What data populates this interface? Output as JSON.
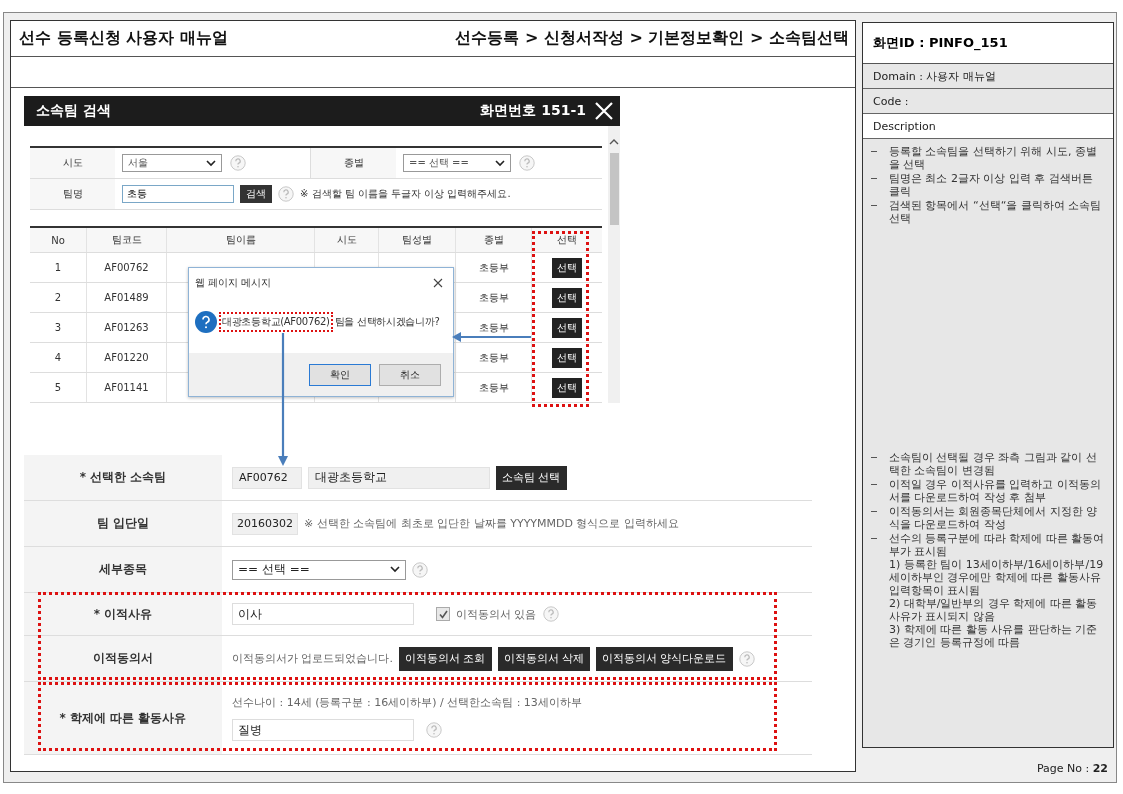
{
  "document": {
    "title": "선수 등록신청 사용자 매뉴얼",
    "breadcrumb": "선수등록 > 신청서작성 > 기본정보확인 > 소속팀선택"
  },
  "popup": {
    "title": "소속팀 검색",
    "screen_no": "화면번호 151-1",
    "filters": [
      {
        "label": "시도",
        "value": "서울"
      },
      {
        "label": "종별",
        "value": "== 선택 =="
      }
    ],
    "team_name": {
      "label": "팀명",
      "value": "초등",
      "button": "검색",
      "note": "※ 검색할 팀 이름을 두글자 이상 입력해주세요."
    },
    "columns": [
      "No",
      "팀코드",
      "팀이름",
      "시도",
      "팀성별",
      "종별",
      "선택"
    ],
    "rows": [
      {
        "no": "1",
        "code": "AF00762",
        "category": "초등부",
        "action": "선택"
      },
      {
        "no": "2",
        "code": "AF01489",
        "category": "초등부",
        "action": "선택"
      },
      {
        "no": "3",
        "code": "AF01263",
        "category": "초등부",
        "action": "선택"
      },
      {
        "no": "4",
        "code": "AF01220",
        "category": "초등부",
        "action": "선택"
      },
      {
        "no": "5",
        "code": "AF01141",
        "category": "초등부",
        "action": "선택"
      }
    ]
  },
  "dialog": {
    "title": "웹 페이지 메시지",
    "team": "대광초등학교(AF00762)",
    "message": "팀을 선택하시겠습니까?",
    "buttons": [
      {
        "label": "확인",
        "selected": true
      },
      {
        "label": "취소",
        "selected": false
      }
    ]
  },
  "form": {
    "rows": [
      {
        "kind": "team",
        "label": "* 선택한 소속팀",
        "code": "AF00762",
        "name": "대광초등학교",
        "button": "소속팀 선택"
      },
      {
        "kind": "date",
        "label": "팀 입단일",
        "value": "20160302",
        "note": "※ 선택한 소속팀에 최초로 입단한 날짜를 YYYYMMDD 형식으로 입력하세요"
      },
      {
        "kind": "select",
        "label": "세부종목",
        "value": "== 선택 =="
      },
      {
        "kind": "reason",
        "label": "* 이적사유",
        "value": "이사",
        "checkbox": {
          "label": "이적동의서 있음",
          "checked": true
        }
      },
      {
        "kind": "consent",
        "label": "이적동의서",
        "status": "이적동의서가 업로드되었습니다.",
        "buttons": [
          "이적동의서 조회",
          "이적동의서 삭제",
          "이적동의서 양식다운로드"
        ]
      },
      {
        "kind": "activity",
        "label": "* 학제에 따른 활동사유",
        "info": "선수나이 : 14세 (등록구분 : 16세이하부) / 선택한소속팀 : 13세이하부",
        "value": "질병"
      }
    ]
  },
  "info": {
    "screen_id": "화면ID : PINFO_151",
    "domain": "Domain : 사용자 매뉴얼",
    "code": "Code :",
    "description": "Description",
    "notes": [
      [
        {
          "text": "등록할 소속팀을 선택하기 위해 시도, 종별을 선택"
        },
        {
          "text": "팀명은 최소 2글자 이상 입력 후 검색버튼 클릭"
        },
        {
          "text": "검색된 항목에서 “선택“을 클릭하여 소속팀 선택"
        }
      ],
      [
        {
          "text": "소속팀이 선택될 경우 좌측 그림과 같이 선택한 소속팀이 변경됨"
        },
        {
          "text": "이적일 경우 이적사유를 입력하고 이적동의서를 다운로드하여 작성 후 첨부"
        },
        {
          "text": "이적동의서는 회원종목단체에서 지정한 양식을 다운로드하여 작성"
        },
        {
          "text": "선수의 등록구분에 따라 학제에 따른 활동여부가 표시됨",
          "sub": [
            "1) 등록한 팀이 13세이하부/16세이하부/19세이하부인 경우에만 학제에 따른 활동사유 입력항목이 표시됨",
            "2) 대학부/일반부의 경우 학제에 따른 활동 사유가 표시되지 않음",
            "3) 학제에 따른 활동 사유를 판단하는 기준은 경기인 등록규정에 따름"
          ]
        }
      ]
    ],
    "page_no": "Page No : **22**"
  }
}
